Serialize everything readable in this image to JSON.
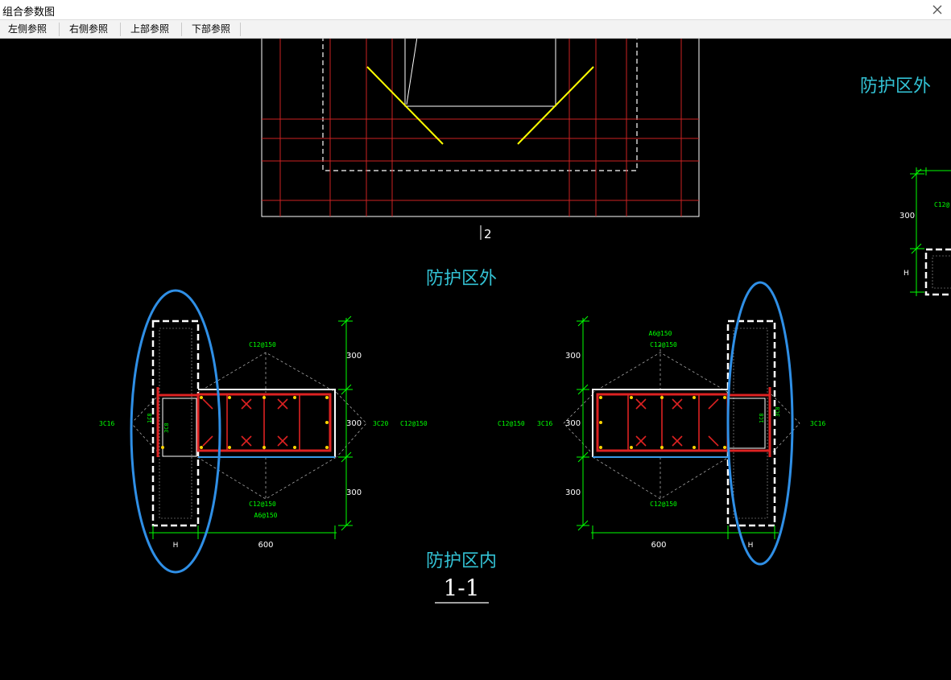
{
  "window": {
    "title": "组合参数图"
  },
  "toolbar": {
    "left_ref": "左侧参照",
    "right_ref": "右侧参照",
    "top_ref": "上部参照",
    "bottom_ref": "下部参照"
  },
  "icons": {
    "close": "close-icon"
  },
  "colors": {
    "background": "#000000",
    "cyan_label": "#33c2d4",
    "green_dim": "#00ff00",
    "red_rebar": "#dd2222",
    "yellow_line": "#ffff00",
    "blue_ellipse": "#2f8fe6",
    "white_outline": "#ffffff"
  },
  "drawing": {
    "top_label": "防护区外",
    "middle_label": "防护区外",
    "bottom_label": "防护区内",
    "section_label": "1-1",
    "column_marker": "2",
    "left_detail": {
      "dim_300_top": "300",
      "dim_300_mid": "300",
      "dim_300_bot": "300",
      "dim_600": "600",
      "dim_h": "H",
      "rebar_top": "C12@150",
      "rebar_bot": "C12@150",
      "rebar_bot2": "A6@150",
      "rebar_side_left": "3C16",
      "rebar_side_right": "3C20",
      "rebar_side_far": "C12@150",
      "rebar_vert_a": "1C8",
      "rebar_vert_b": "3C8"
    },
    "right_detail": {
      "dim_300_top": "300",
      "dim_300_mid": "300",
      "dim_300_bot": "300",
      "dim_600": "600",
      "dim_h": "H",
      "rebar_top": "A6@150",
      "rebar_top2": "C12@150",
      "rebar_bot": "C12@150",
      "rebar_side_left": "C12@150",
      "rebar_side_mid": "3C16",
      "rebar_side_right": "3C16",
      "rebar_vert_a": "1C8",
      "rebar_vert_b": "3C8"
    },
    "far_right_detail": {
      "dim_300": "300",
      "dim_h": "H",
      "rebar_top": "C12@"
    }
  }
}
